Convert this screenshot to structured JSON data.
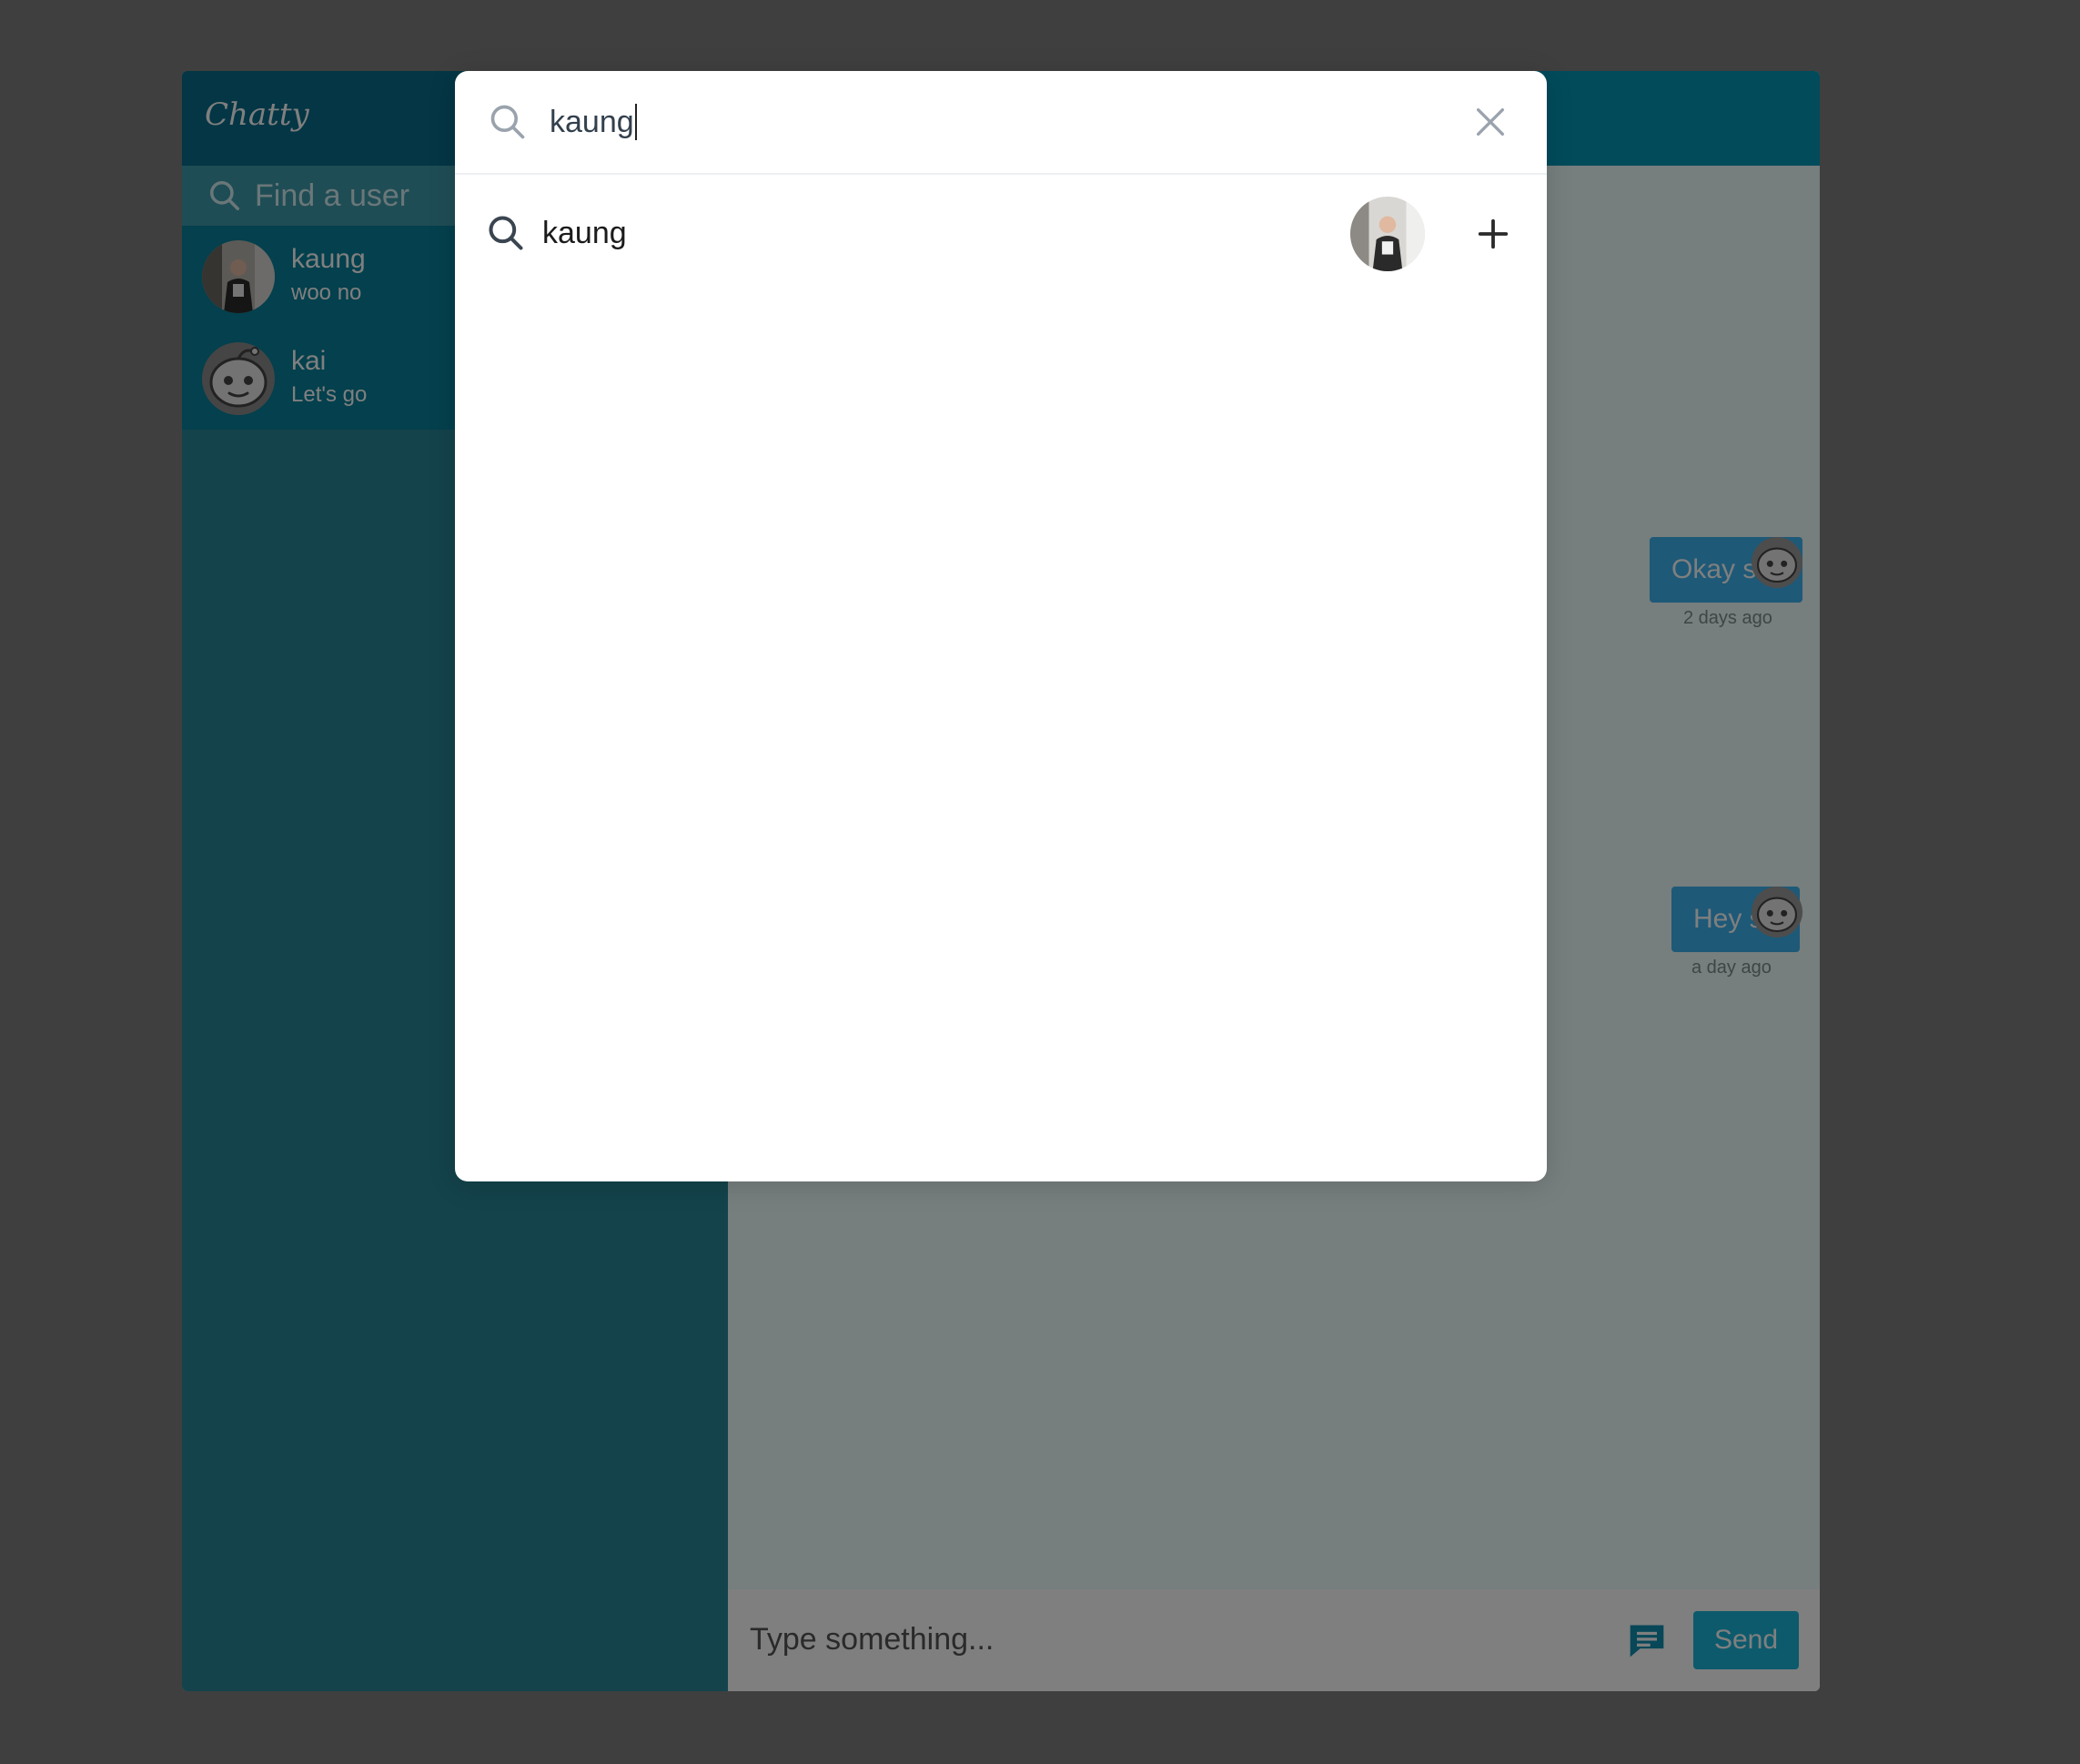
{
  "app": {
    "title": "Chatty",
    "find_user_placeholder": "Find a user"
  },
  "conversations": [
    {
      "name": "kaung",
      "preview": "woo no",
      "avatar": "photo-avatar"
    },
    {
      "name": "kai",
      "preview": "Let's go",
      "avatar": "cartoon-avatar"
    }
  ],
  "messages": [
    {
      "text": "Okay ser",
      "time": "2 days ago"
    },
    {
      "text": "Hey sir",
      "time": "a day ago"
    }
  ],
  "composer": {
    "placeholder": "Type something...",
    "send_label": "Send"
  },
  "search_modal": {
    "query": "kaung",
    "results": [
      {
        "label": "kaung",
        "avatar": "photo-avatar",
        "action_icon": "plus-icon"
      }
    ]
  },
  "colors": {
    "sidebar_header": "#096d8a",
    "sidebar": "#288797",
    "main_header": "#0497b6",
    "bubble": "#3cb2ee",
    "send_button": "#1bb5d8",
    "overlay": "rgba(0,0,0,0.5)"
  }
}
